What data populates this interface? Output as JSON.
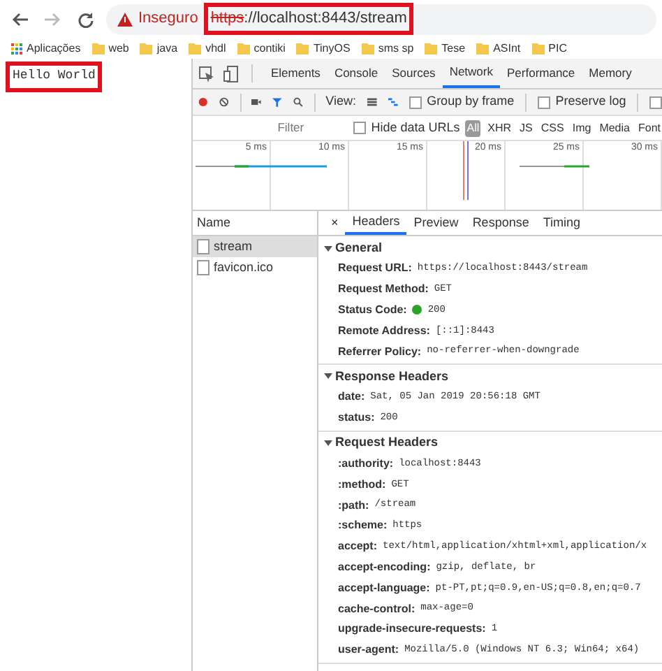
{
  "browser": {
    "nav_buttons": [
      {
        "kind": "back",
        "disabled": false
      },
      {
        "kind": "forward",
        "disabled": true
      },
      {
        "kind": "reload",
        "disabled": false
      }
    ],
    "security_label": "Inseguro",
    "address": {
      "scheme": "https",
      "rest": "://localhost:8443/stream",
      "highlighted": true
    },
    "bookmarks": [
      {
        "kind": "apps",
        "label": "Aplicações"
      },
      {
        "kind": "folder",
        "label": "web"
      },
      {
        "kind": "folder",
        "label": "java"
      },
      {
        "kind": "folder",
        "label": "vhdl"
      },
      {
        "kind": "folder",
        "label": "contiki"
      },
      {
        "kind": "folder",
        "label": "TinyOS"
      },
      {
        "kind": "folder",
        "label": "sms sp"
      },
      {
        "kind": "folder",
        "label": "Tese"
      },
      {
        "kind": "folder",
        "label": "ASInt"
      },
      {
        "kind": "folder",
        "label": "PIC"
      }
    ]
  },
  "page": {
    "text": "Hello World",
    "highlighted": true
  },
  "devtools": {
    "tabs": [
      {
        "label": "Elements",
        "selected": false
      },
      {
        "label": "Console",
        "selected": false
      },
      {
        "label": "Sources",
        "selected": false
      },
      {
        "label": "Network",
        "selected": true
      },
      {
        "label": "Performance",
        "selected": false
      },
      {
        "label": "Memory",
        "selected": false
      }
    ],
    "toolbar": {
      "recording": true,
      "filter_active": true,
      "view_label": "View:",
      "checkboxes": [
        {
          "label": "Group by frame",
          "checked": false
        },
        {
          "label": "Preserve log",
          "checked": false
        },
        {
          "checked": false
        }
      ]
    },
    "filter": {
      "placeholder": "Filter",
      "hide_data_urls": {
        "label": "Hide data URLs",
        "checked": false
      },
      "types": [
        {
          "label": "All",
          "selected": true
        },
        {
          "label": "XHR",
          "selected": false
        },
        {
          "label": "JS",
          "selected": false
        },
        {
          "label": "CSS",
          "selected": false
        },
        {
          "label": "Img",
          "selected": false
        },
        {
          "label": "Media",
          "selected": false
        },
        {
          "label": "Font",
          "selected": false
        }
      ]
    },
    "timeline": {
      "ticks": [
        "5 ms",
        "10 ms",
        "15 ms",
        "20 ms",
        "25 ms",
        "30 ms"
      ]
    },
    "requests": {
      "column": "Name",
      "items": [
        {
          "name": "stream",
          "selected": true
        },
        {
          "name": "favicon.ico",
          "selected": false
        }
      ]
    },
    "detail_tabs": {
      "close": "×",
      "tabs": [
        {
          "label": "Headers",
          "selected": true
        },
        {
          "label": "Preview",
          "selected": false
        },
        {
          "label": "Response",
          "selected": false
        },
        {
          "label": "Timing",
          "selected": false
        }
      ]
    },
    "sections": [
      {
        "title": "General",
        "expanded": true,
        "rows": [
          {
            "key": "Request URL:",
            "value": "https://localhost:8443/stream"
          },
          {
            "key": "Request Method:",
            "value": "GET"
          },
          {
            "key": "Status Code:",
            "value": "200",
            "color": "#2aa52a"
          },
          {
            "key": "Remote Address:",
            "value": "[::1]:8443"
          },
          {
            "key": "Referrer Policy:",
            "value": "no-referrer-when-downgrade"
          }
        ]
      },
      {
        "title": "Response Headers",
        "expanded": true,
        "rows": [
          {
            "key": "date:",
            "value": "Sat, 05 Jan 2019 20:56:18 GMT"
          },
          {
            "key": "status:",
            "value": "200"
          }
        ]
      },
      {
        "title": "Request Headers",
        "expanded": true,
        "rows": [
          {
            "key": ":authority:",
            "value": "localhost:8443"
          },
          {
            "key": ":method:",
            "value": "GET"
          },
          {
            "key": ":path:",
            "value": "/stream"
          },
          {
            "key": ":scheme:",
            "value": "https"
          },
          {
            "key": "accept:",
            "value": "text/html,application/xhtml+xml,application/x"
          },
          {
            "key": "accept-encoding:",
            "value": "gzip, deflate, br"
          },
          {
            "key": "accept-language:",
            "value": "pt-PT,pt;q=0.9,en-US;q=0.8,en;q=0.7"
          },
          {
            "key": "cache-control:",
            "value": "max-age=0"
          },
          {
            "key": "upgrade-insecure-requests:",
            "value": "1"
          },
          {
            "key": "user-agent:",
            "value": "Mozilla/5.0 (Windows NT 6.3; Win64; x64)"
          }
        ]
      }
    ]
  }
}
